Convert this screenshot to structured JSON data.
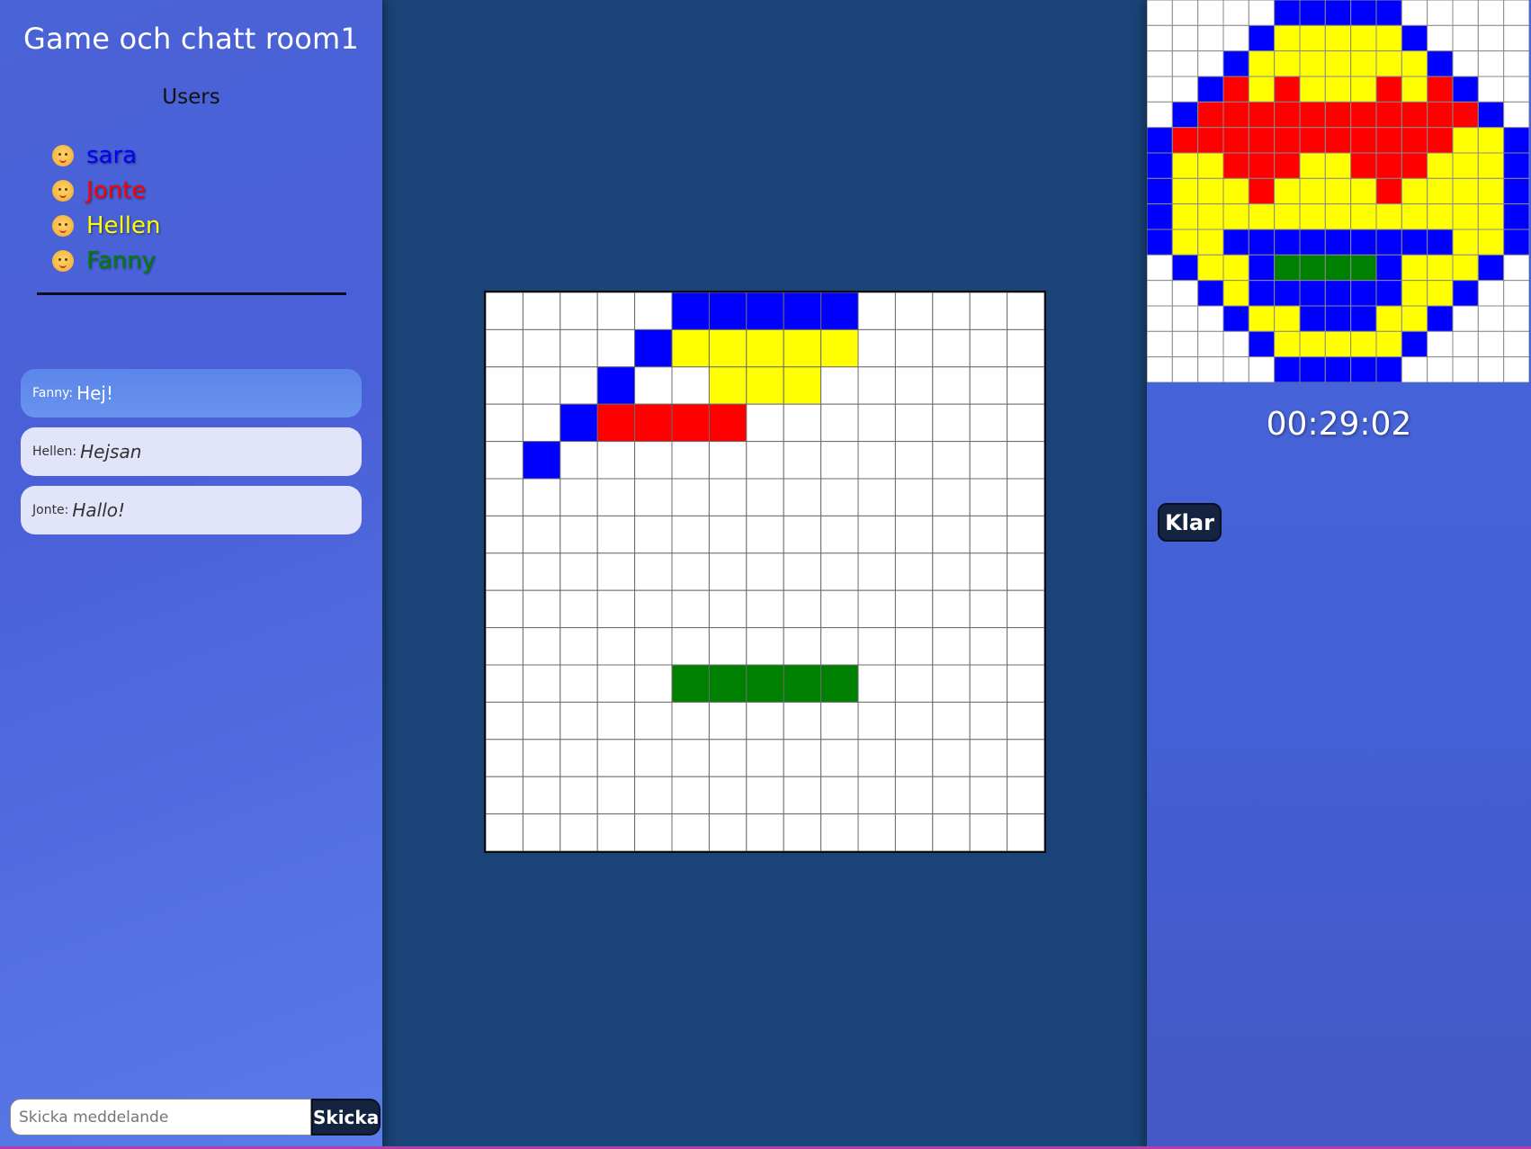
{
  "sidebar": {
    "title": "Game och chatt room1",
    "users_heading": "Users",
    "users": [
      {
        "name": "sara",
        "color": "#0000ff"
      },
      {
        "name": "Jonte",
        "color": "#ff0000"
      },
      {
        "name": "Hellen",
        "color": "#ffff00"
      },
      {
        "name": "Fanny",
        "color": "#008000"
      }
    ],
    "messages": [
      {
        "from": "Fanny:",
        "text": "Hej!"
      },
      {
        "from": "Hellen:",
        "text": "Hejsan"
      },
      {
        "from": "Jonte:",
        "text": "Hallo!"
      }
    ],
    "input_placeholder": "Skicka meddelande",
    "send_label": "Skicka"
  },
  "palette": {
    "W": "#ffffff",
    "B": "#0000ff",
    "Y": "#ffff00",
    "R": "#ff0000",
    "G": "#008000"
  },
  "board": {
    "rows": [
      "WWWWWBBBBBWWWWW",
      "WWWWBYYYYYWWWWW",
      "WWWBWWYYYWWWWWW",
      "WWBRRRRWWWWWWWW",
      "WBWWWWWWWWWWWWW",
      "WWWWWWWWWWWWWWW",
      "WWWWWWWWWWWWWWW",
      "WWWWWWWWWWWWWWW",
      "WWWWWWWWWWWWWWW",
      "WWWWWWWWWWWWWWW",
      "WWWWWGGGGGWWWWW",
      "WWWWWWWWWWWWWWW",
      "WWWWWWWWWWWWWWW",
      "WWWWWWWWWWWWWWW",
      "WWWWWWWWWWWWWWW"
    ]
  },
  "target": {
    "rows": [
      "WWWWWBBBBBWWWWW",
      "WWWWBYYYYYBWWWW",
      "WWWBYYYYYYYBWWW",
      "WWBRYRYYYRYRBWW",
      "WBRRRRRRRRRRRBW",
      "BRRRRRRRRRRRYYB",
      "BYYRRRYYRRRYYYB",
      "BYYYRYYYYRYYYYB",
      "BYYYYYYYYYYYYYB",
      "BYYBBBBBBBBBYYB",
      "WBYYBGGGGBYYYBW",
      "WWBYBBBBBBYYBWW",
      "WWWBYYBBBYYBWWW",
      "WWWWBYYYYYBWWWW",
      "WWWWWBBBBBWWWWW"
    ]
  },
  "timer": "00:29:02",
  "done_label": "Klar"
}
